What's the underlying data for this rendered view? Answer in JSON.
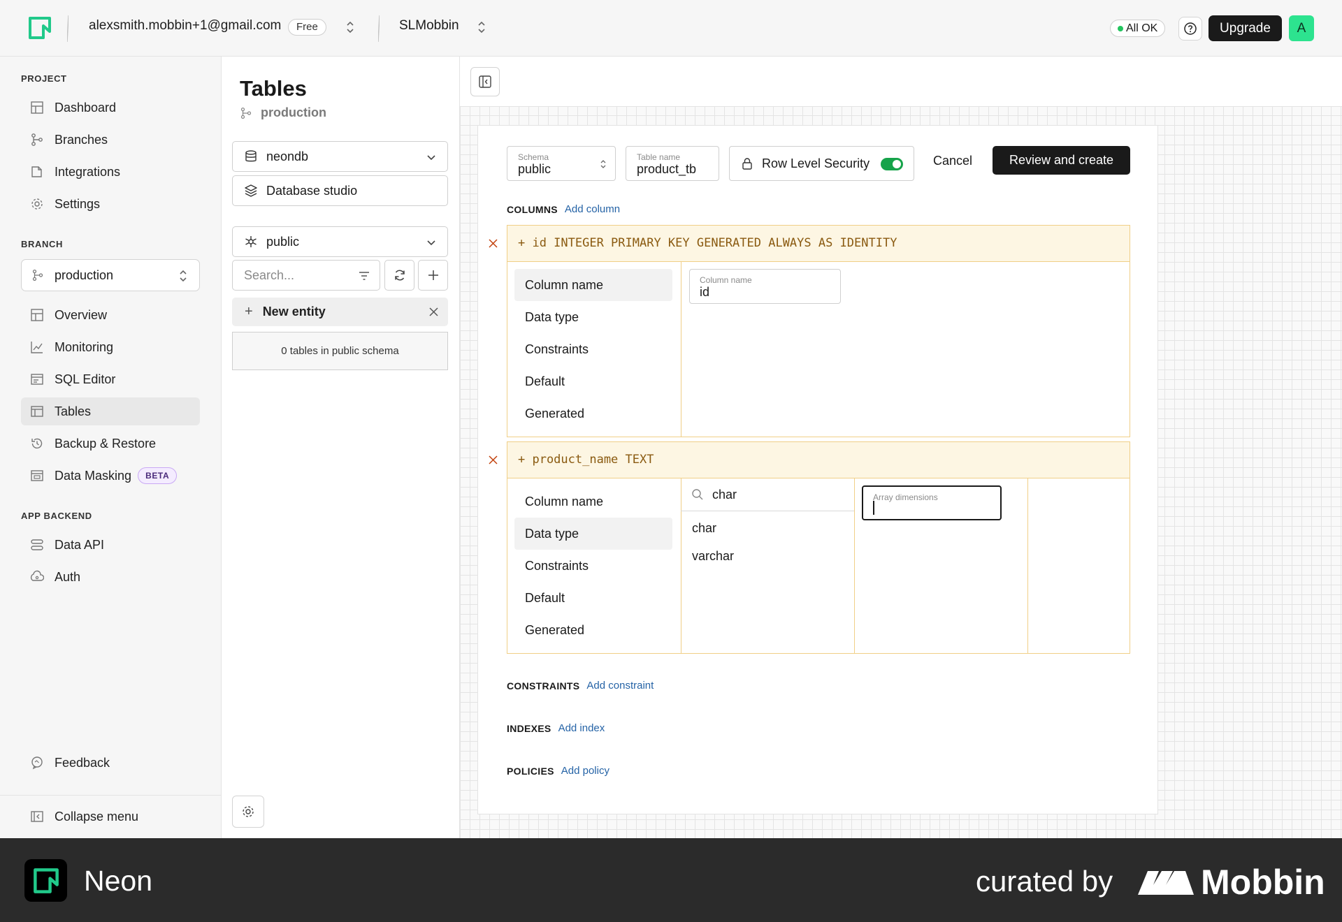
{
  "topbar": {
    "account": "alexsmith.mobbin+1@gmail.com",
    "plan_badge": "Free",
    "project": "SLMobbin",
    "status": "All OK",
    "upgrade_label": "Upgrade",
    "avatar_initial": "A"
  },
  "nav": {
    "project_section": "PROJECT",
    "project_items": [
      {
        "label": "Dashboard",
        "icon": "dashboard-icon"
      },
      {
        "label": "Branches",
        "icon": "branches-icon"
      },
      {
        "label": "Integrations",
        "icon": "integrations-icon"
      },
      {
        "label": "Settings",
        "icon": "gear-icon"
      }
    ],
    "branch_section": "BRANCH",
    "branch_selected": "production",
    "branch_items": [
      {
        "label": "Overview",
        "icon": "overview-icon"
      },
      {
        "label": "Monitoring",
        "icon": "chart-icon"
      },
      {
        "label": "SQL Editor",
        "icon": "sql-editor-icon"
      },
      {
        "label": "Tables",
        "icon": "table-icon",
        "active": true
      },
      {
        "label": "Backup & Restore",
        "icon": "history-icon"
      },
      {
        "label": "Data Masking",
        "icon": "mask-icon",
        "badge": "BETA"
      }
    ],
    "app_section": "APP BACKEND",
    "app_items": [
      {
        "label": "Data API",
        "icon": "api-icon"
      },
      {
        "label": "Auth",
        "icon": "auth-icon"
      }
    ],
    "feedback": "Feedback",
    "collapse": "Collapse menu"
  },
  "tables_panel": {
    "title": "Tables",
    "branch": "production",
    "database": "neondb",
    "studio": "Database studio",
    "schema": "public",
    "search_placeholder": "Search...",
    "new_entity": "New entity",
    "empty_text": "0 tables in public schema"
  },
  "editor": {
    "schema_label": "Schema",
    "schema_value": "public",
    "table_name_label": "Table name",
    "table_name_value": "product_tb",
    "rls_label": "Row Level Security",
    "rls_enabled": true,
    "cancel_label": "Cancel",
    "review_label": "Review and create",
    "columns_section": "COLUMNS",
    "add_column": "Add column",
    "columns": [
      {
        "definition": "+ id INTEGER PRIMARY KEY GENERATED ALWAYS AS IDENTITY",
        "tabs": [
          "Column name",
          "Data type",
          "Constraints",
          "Default",
          "Generated"
        ],
        "active_tab": "Column name",
        "field_label": "Column name",
        "field_value": "id"
      },
      {
        "definition": "+ product_name TEXT",
        "tabs": [
          "Column name",
          "Data type",
          "Constraints",
          "Default",
          "Generated"
        ],
        "active_tab": "Data type",
        "type_search": "char",
        "type_options": [
          "char",
          "varchar"
        ],
        "array_label": "Array dimensions",
        "array_value": ""
      }
    ],
    "constraints_section": "CONSTRAINTS",
    "add_constraint": "Add constraint",
    "indexes_section": "INDEXES",
    "add_index": "Add index",
    "policies_section": "POLICIES",
    "add_policy": "Add policy"
  },
  "footer": {
    "brand": "Neon",
    "curated": "curated by",
    "mobbin": "Mobbin"
  },
  "colors": {
    "accent_green": "#2de38f",
    "toggle_on": "#16a34a",
    "column_border": "#f0cf87",
    "column_header_bg": "#fdf6e3",
    "link": "#2563a6"
  }
}
